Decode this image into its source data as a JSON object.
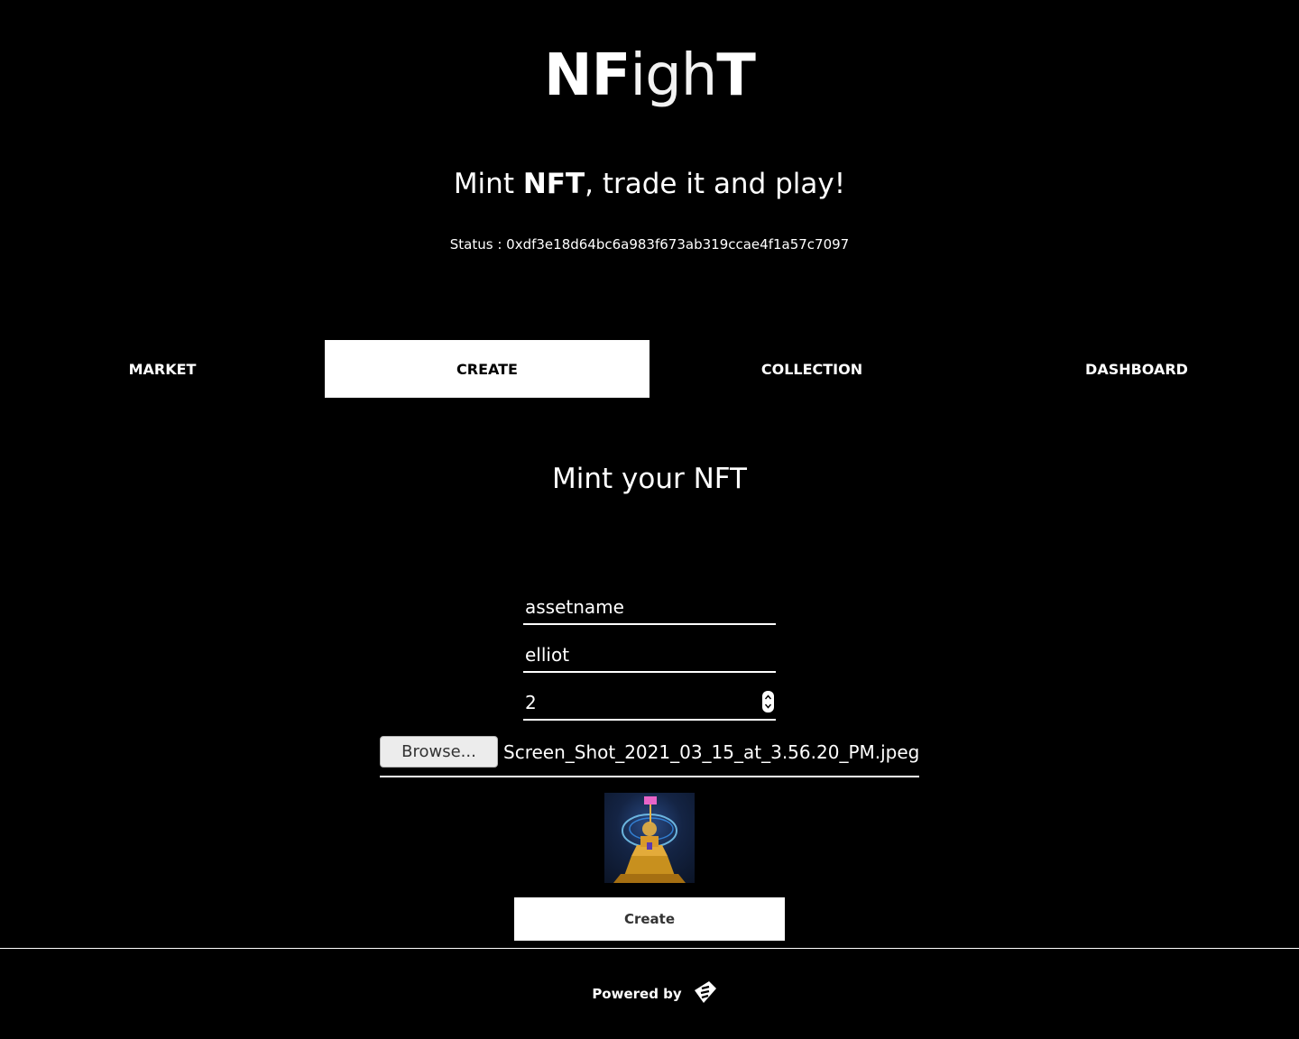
{
  "header": {
    "logo_part1": "NF",
    "logo_part2": "igh",
    "logo_part3": "T",
    "tagline_pre": "Mint ",
    "tagline_bold": "NFT",
    "tagline_post": ", trade it and play!",
    "status": "Status : 0xdf3e18d64bc6a983f673ab319ccae4f1a57c7097"
  },
  "tabs": [
    {
      "label": "MARKET",
      "active": false
    },
    {
      "label": "CREATE",
      "active": true
    },
    {
      "label": "COLLECTION",
      "active": false
    },
    {
      "label": "DASHBOARD",
      "active": false
    }
  ],
  "form": {
    "title": "Mint your NFT",
    "asset_name": "assetname",
    "owner": "elliot",
    "quantity": "2",
    "browse_label": "Browse...",
    "file_name": "Screen_Shot_2021_03_15_at_3.56.20_PM.jpeg",
    "create_label": "Create"
  },
  "footer": {
    "powered_by": "Powered by",
    "logo_icon": "ethereum-style-logo-icon"
  },
  "colors": {
    "background": "#000000",
    "foreground": "#ffffff",
    "active_tab_bg": "#ffffff",
    "active_tab_text": "#000000"
  }
}
